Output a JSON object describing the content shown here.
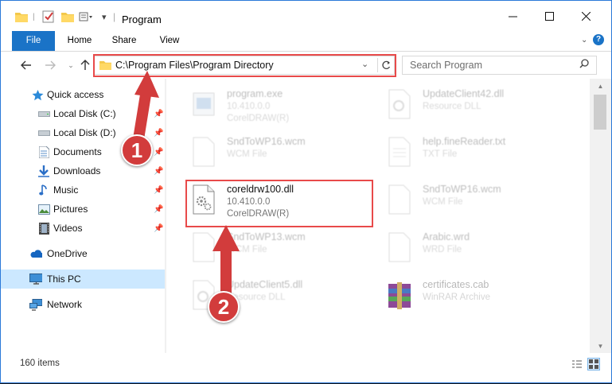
{
  "window": {
    "title": "Program"
  },
  "ribbon": {
    "tabs": [
      "File",
      "Home",
      "Share",
      "View"
    ]
  },
  "address": {
    "path": "C:\\Program Files\\Program Directory"
  },
  "search": {
    "placeholder": "Search Program"
  },
  "sidebar": {
    "items": [
      {
        "label": "Quick access",
        "icon": "star-icon",
        "pinned": false
      },
      {
        "label": "Local Disk (C:)",
        "icon": "drive-icon",
        "pinned": true
      },
      {
        "label": "Local Disk (D:)",
        "icon": "drive-icon",
        "pinned": true
      },
      {
        "label": "Documents",
        "icon": "documents-icon",
        "pinned": true
      },
      {
        "label": "Downloads",
        "icon": "downloads-icon",
        "pinned": true
      },
      {
        "label": "Music",
        "icon": "music-icon",
        "pinned": true
      },
      {
        "label": "Pictures",
        "icon": "pictures-icon",
        "pinned": true
      },
      {
        "label": "Videos",
        "icon": "videos-icon",
        "pinned": true
      },
      {
        "label": "OneDrive",
        "icon": "cloud-icon",
        "pinned": false
      },
      {
        "label": "This PC",
        "icon": "computer-icon",
        "pinned": false,
        "selected": true
      },
      {
        "label": "Network",
        "icon": "network-icon",
        "pinned": false
      }
    ]
  },
  "files": [
    {
      "name": "program.exe",
      "line2": "10.410.0.0",
      "line3": "CorelDRAW(R)"
    },
    {
      "name": "UpdateClient42.dll",
      "line2": "Resource DLL",
      "line3": ""
    },
    {
      "name": "SndToWP16.wcm",
      "line2": "WCM File",
      "line3": ""
    },
    {
      "name": "help.fineReader.txt",
      "line2": "TXT File",
      "line3": ""
    },
    {
      "name": "coreldrw100.dll",
      "line2": "10.410.0.0",
      "line3": "CorelDRAW(R)"
    },
    {
      "name": "SndToWP16.wcm",
      "line2": "WCM File",
      "line3": ""
    },
    {
      "name": "SndToWP13.wcm",
      "line2": "WCM File",
      "line3": ""
    },
    {
      "name": "Arabic.wrd",
      "line2": "WRD File",
      "line3": ""
    },
    {
      "name": "UpdateClient5.dll",
      "line2": "Resource DLL",
      "line3": ""
    },
    {
      "name": "certificates.cab",
      "line2": "WinRAR Archive",
      "line3": ""
    }
  ],
  "status": {
    "count": "160 items"
  },
  "annotations": {
    "step1": "1",
    "step2": "2",
    "color": "#d23c3c"
  },
  "colors": {
    "accent": "#1a73c7",
    "highlight": "#e84a4a",
    "selection": "#cce8ff"
  }
}
